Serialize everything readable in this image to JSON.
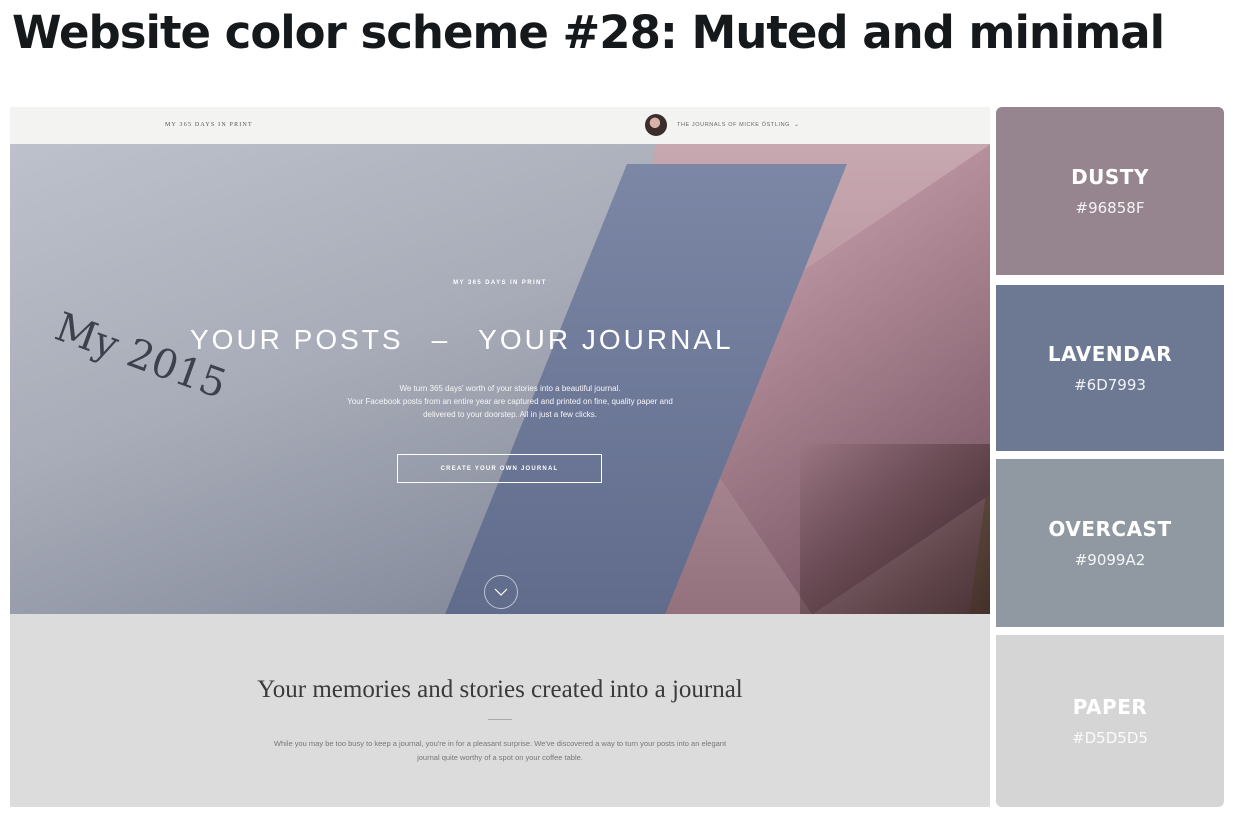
{
  "heading": "Website color scheme #28: Muted and minimal",
  "screenshot": {
    "topbar": {
      "brand": "MY 365 DAYS IN PRINT",
      "user_link": "THE JOURNALS OF MICKE ÖSTLING",
      "user_chevron": "⌄"
    },
    "hero": {
      "script_text": "My 2015",
      "kicker": "MY 365 DAYS IN PRINT",
      "title_left": "YOUR POSTS",
      "title_dash": "–",
      "title_right": "YOUR JOURNAL",
      "body_line1": "We turn 365 days' worth of your stories into a beautiful journal.",
      "body_line2": "Your Facebook posts from an entire year are captured and printed on fine, quality paper and",
      "body_line3": "delivered to your doorstep. All in just a few clicks.",
      "cta_label": "CREATE YOUR OWN JOURNAL",
      "scroll_icon": "chevron-down-icon"
    },
    "intro": {
      "title": "Your memories and stories created into a journal",
      "body_line1": "While you may be too busy to keep a journal, you're in for a pleasant surprise. We've discovered a way to turn your posts into an elegant",
      "body_line2": "journal quite worthy of a spot on your coffee table."
    }
  },
  "palette": [
    {
      "name": "DUSTY",
      "hex": "#96858F",
      "color": "#96858F"
    },
    {
      "name": "LAVENDAR",
      "hex": "#6D7993",
      "color": "#6D7993"
    },
    {
      "name": "OVERCAST",
      "hex": "#9099A2",
      "color": "#9099A2"
    },
    {
      "name": "PAPER",
      "hex": "#D5D5D5",
      "color": "#D5D5D5"
    }
  ]
}
